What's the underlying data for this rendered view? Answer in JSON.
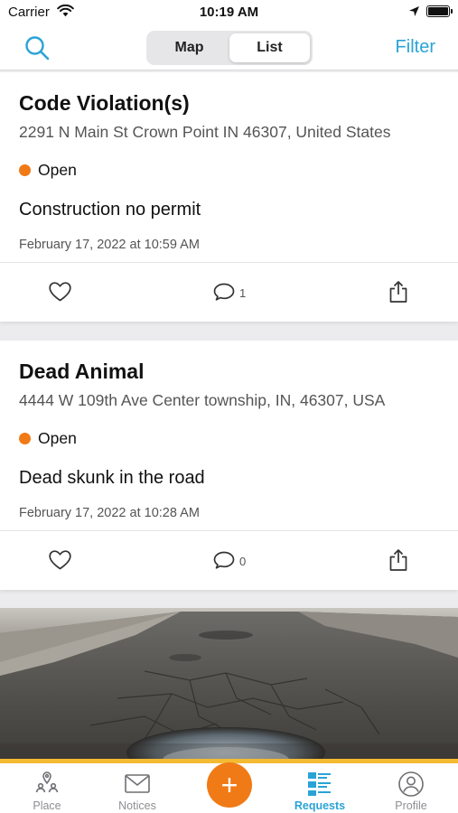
{
  "status_bar": {
    "carrier": "Carrier",
    "time": "10:19 AM"
  },
  "nav": {
    "segments": [
      "Map",
      "List"
    ],
    "active_segment": "List",
    "filter_label": "Filter"
  },
  "requests": [
    {
      "title": "Code Violation(s)",
      "address": "2291 N Main St Crown Point IN 46307, United States",
      "status": "Open",
      "description": "Construction no permit",
      "date": "February 17, 2022 at 10:59 AM",
      "comment_count": "1"
    },
    {
      "title": "Dead Animal",
      "address": "4444 W 109th Ave Center township, IN, 46307, USA",
      "status": "Open",
      "description": "Dead skunk in the road",
      "date": "February 17, 2022 at 10:28 AM",
      "comment_count": "0"
    }
  ],
  "tab_bar": {
    "tabs": [
      {
        "label": "Place",
        "icon": "place-icon"
      },
      {
        "label": "Notices",
        "icon": "mail-icon"
      },
      {
        "label": "Requests",
        "icon": "list-icon"
      },
      {
        "label": "Profile",
        "icon": "profile-icon"
      }
    ],
    "active_tab": "Requests",
    "add_label": "+"
  },
  "colors": {
    "accent": "#2aa3d6",
    "status_open": "#f07a16",
    "fab": "#f07a16",
    "tab_bar_border": "#f3bb33"
  }
}
